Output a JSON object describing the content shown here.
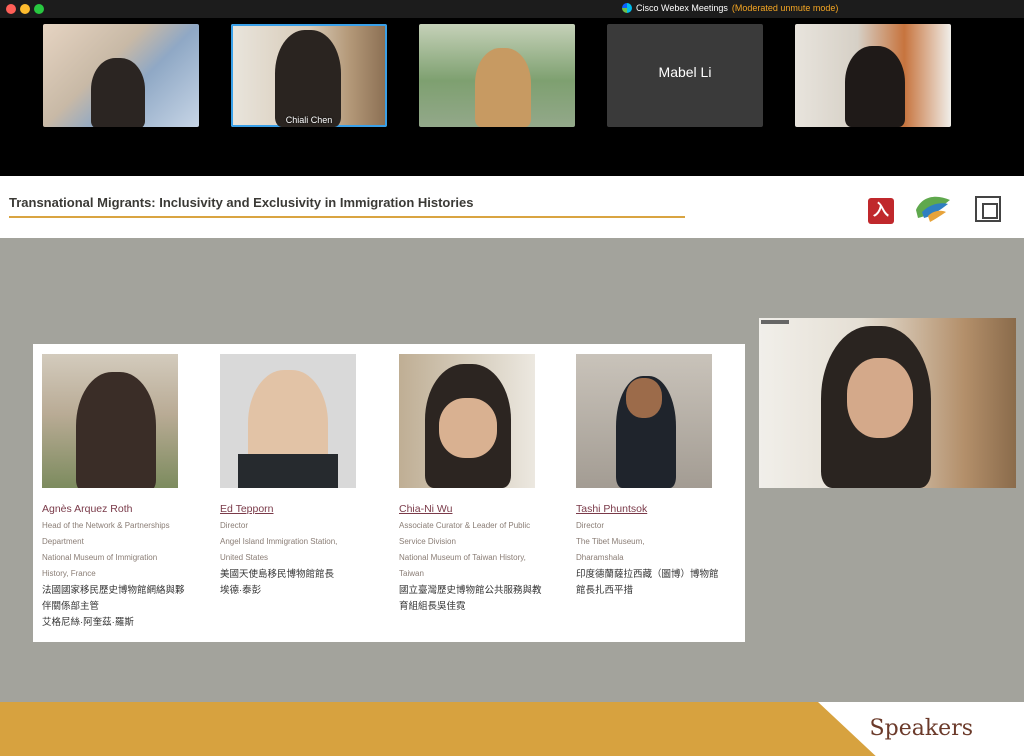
{
  "app": {
    "name": "Cisco Webex Meetings",
    "mode": "(Moderated unmute mode)"
  },
  "participants": [
    {
      "name": ""
    },
    {
      "name": "Chiali Chen",
      "active": true
    },
    {
      "name": ""
    },
    {
      "name": "Mabel Li",
      "video": false
    },
    {
      "name": ""
    }
  ],
  "slide": {
    "title": "Transnational Migrants: Inclusivity and Exclusivity in Immigration Histories",
    "footer": "Speakers",
    "colors": {
      "accent": "#d9a441",
      "band": "#d7a23f",
      "name": "#7a3a49",
      "logo_red": "#c0282c"
    },
    "speakers": [
      {
        "name": "Agnès Arquez Roth",
        "role_lines": [
          "Head of the Network & Partnerships",
          "Department",
          "National Museum of Immigration",
          "History, France"
        ],
        "zh_lines": [
          "法國國家移民歷史博物館網絡與夥",
          "伴關係部主管",
          "艾格尼絲·阿奎茲·羅斯"
        ]
      },
      {
        "name": "Ed Tepporn",
        "role_lines": [
          "Director",
          "Angel Island Immigration Station,",
          "United States"
        ],
        "zh_lines": [
          "美國天使島移民博物館館長",
          "埃德·泰彭"
        ]
      },
      {
        "name": "Chia-Ni Wu",
        "role_lines": [
          "Associate Curator & Leader of Public",
          "Service Division",
          "National Museum of Taiwan History,",
          "Taiwan"
        ],
        "zh_lines": [
          "國立臺灣歷史博物館公共服務與教",
          "育組組長吳佳霓"
        ]
      },
      {
        "name": "Tashi Phuntsok",
        "role_lines": [
          "Director",
          "The Tibet Museum,",
          "Dharamshala"
        ],
        "zh_lines": [
          "印度德蘭薩拉西藏（圖博）博物館",
          "館長扎西平措"
        ]
      }
    ]
  }
}
